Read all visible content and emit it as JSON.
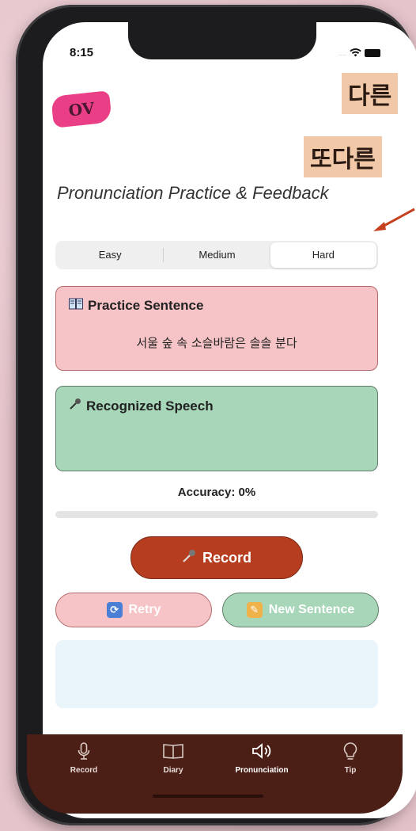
{
  "status_bar": {
    "time": "8:15",
    "signal": "....",
    "wifi": "wifi-icon",
    "battery": "battery-icon"
  },
  "logo": {
    "text": "OV"
  },
  "overlays": {
    "label1": "다른",
    "label2": "또다른"
  },
  "app": {
    "title": "Pronunciation Practice & Feedback"
  },
  "difficulty": {
    "options": [
      "Easy",
      "Medium",
      "Hard"
    ],
    "selected": "Hard"
  },
  "practice": {
    "icon": "book-icon",
    "title": "Practice Sentence",
    "sentence": "서울 숲 속 소슬바람은 솔솔 분다"
  },
  "speech": {
    "icon": "microphone-icon",
    "title": "Recognized Speech",
    "text": ""
  },
  "accuracy": {
    "label": "Accuracy: 0%",
    "value": 0
  },
  "buttons": {
    "record": "Record",
    "retry": "Retry",
    "new_sentence": "New Sentence"
  },
  "tabs": [
    {
      "label": "Record",
      "icon": "microphone-icon"
    },
    {
      "label": "Diary",
      "icon": "book-icon"
    },
    {
      "label": "Pronunciation",
      "icon": "speaker-icon",
      "active": true
    },
    {
      "label": "Tip",
      "icon": "lightbulb-icon"
    }
  ],
  "colors": {
    "accent": "#b63d1f",
    "practice_card": "#f6c4c6",
    "speech_card": "#a7d6b9",
    "tabbar": "#4b1f16",
    "logo": "#ea3f86"
  }
}
